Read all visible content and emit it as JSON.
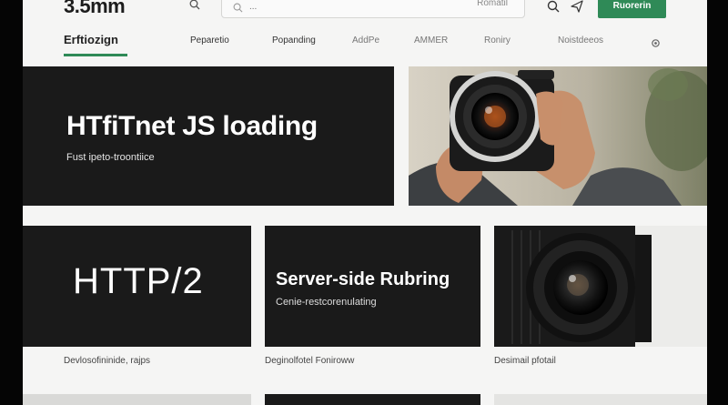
{
  "header": {
    "logo": "3.5mm",
    "search_placeholder": "...",
    "search_button": "Romatil",
    "cta_label": "Ruorerin"
  },
  "subheader": {
    "brand": "Erftiozign",
    "nav": [
      "Peparetio",
      "Popanding",
      "AddPe",
      "AMMER",
      "Roniry",
      "Noistdeeos"
    ]
  },
  "hero": {
    "title": "HTfiTnet JS loading",
    "subtitle": "Fust ipeto-troontiice"
  },
  "cards": [
    {
      "title": "HTTP/2",
      "caption": "Devlosofininide, rajps"
    },
    {
      "title": "Server-side Rubring",
      "subtitle": "Cenie-restcorenulating",
      "caption": "Deginolfotel Foniroww"
    },
    {
      "caption": "Desimail pfotail"
    }
  ],
  "colors": {
    "accent": "#2f8a57",
    "card": "#1a1a1a",
    "background": "#f5f5f4"
  },
  "icons": [
    "search-icon",
    "send-icon",
    "settings-icon",
    "camera-photo"
  ]
}
